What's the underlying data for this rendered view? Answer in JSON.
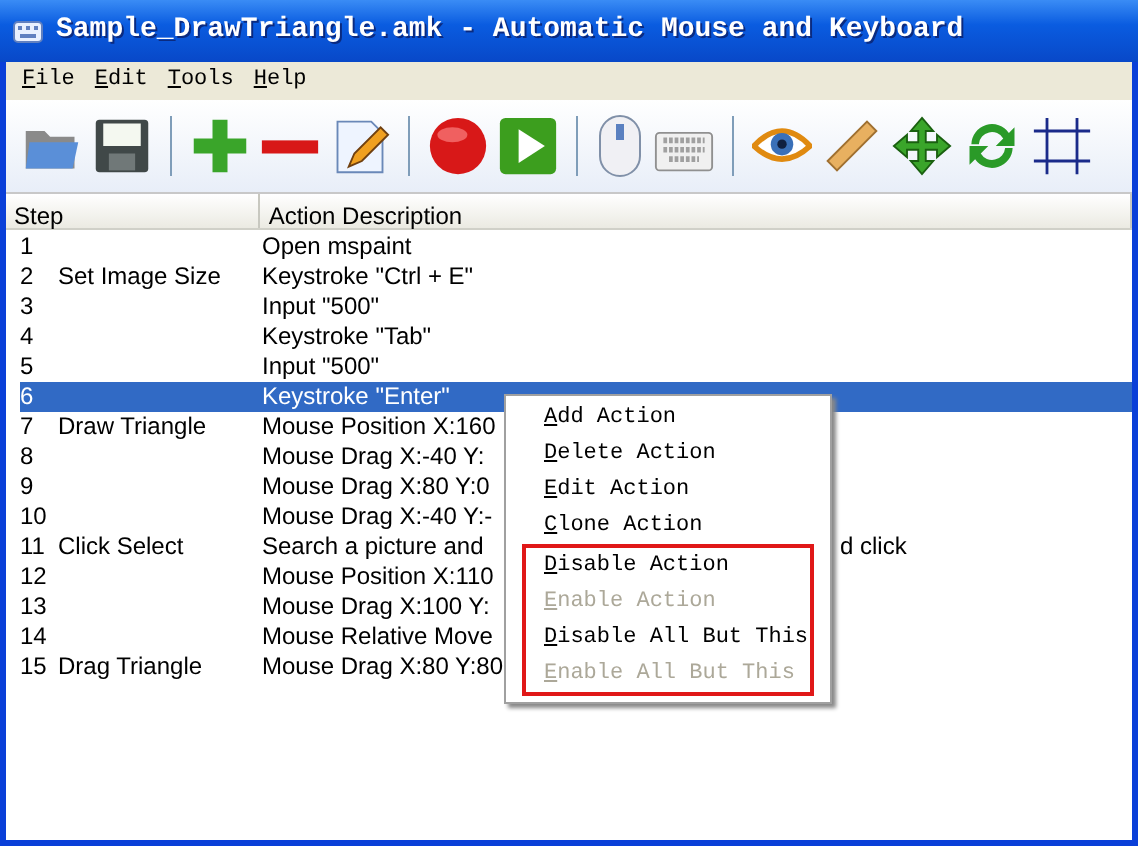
{
  "window": {
    "title": "Sample_DrawTriangle.amk - Automatic Mouse and Keyboard"
  },
  "menu_bar": [
    "File",
    "Edit",
    "Tools",
    "Help"
  ],
  "table": {
    "columns": [
      "Step",
      "Action Description"
    ],
    "rows": [
      {
        "step": "1",
        "name": "",
        "description": "Open mspaint",
        "selected": false
      },
      {
        "step": "2",
        "name": "Set Image Size",
        "description": "Keystroke \"Ctrl + E\"",
        "selected": false
      },
      {
        "step": "3",
        "name": "",
        "description": "Input \"500\"",
        "selected": false
      },
      {
        "step": "4",
        "name": "",
        "description": "Keystroke \"Tab\"",
        "selected": false
      },
      {
        "step": "5",
        "name": "",
        "description": "Input \"500\"",
        "selected": false
      },
      {
        "step": "6",
        "name": "",
        "description": "Keystroke \"Enter\"",
        "selected": true
      },
      {
        "step": "7",
        "name": "Draw Triangle",
        "description": "Mouse Position X:160",
        "selected": false
      },
      {
        "step": "8",
        "name": "",
        "description": "Mouse Drag X:-40 Y:",
        "selected": false
      },
      {
        "step": "9",
        "name": "",
        "description": "Mouse Drag X:80 Y:0",
        "selected": false
      },
      {
        "step": "10",
        "name": "",
        "description": "Mouse Drag X:-40 Y:-",
        "selected": false
      },
      {
        "step": "11",
        "name": "Click Select",
        "description": "Search a picture and",
        "description_tail": "d click",
        "selected": false
      },
      {
        "step": "12",
        "name": "",
        "description": "Mouse Position X:110",
        "selected": false
      },
      {
        "step": "13",
        "name": "",
        "description": "Mouse Drag X:100 Y:",
        "selected": false
      },
      {
        "step": "14",
        "name": "",
        "description": "Mouse Relative Move",
        "selected": false
      },
      {
        "step": "15",
        "name": "Drag Triangle",
        "description": "Mouse Drag X:80 Y:80",
        "selected": false
      }
    ]
  },
  "context_menu": [
    {
      "label": "Add Action",
      "enabled": true,
      "highlighted": false
    },
    {
      "label": "Delete Action",
      "enabled": true,
      "highlighted": false
    },
    {
      "label": "Edit Action",
      "enabled": true,
      "highlighted": false
    },
    {
      "label": "Clone Action",
      "enabled": true,
      "highlighted": false
    },
    {
      "label": "Disable Action",
      "enabled": true,
      "highlighted": true
    },
    {
      "label": "Enable Action",
      "enabled": false,
      "highlighted": true
    },
    {
      "label": "Disable All But This",
      "enabled": true,
      "highlighted": true
    },
    {
      "label": "Enable All But This",
      "enabled": false,
      "highlighted": true
    }
  ]
}
